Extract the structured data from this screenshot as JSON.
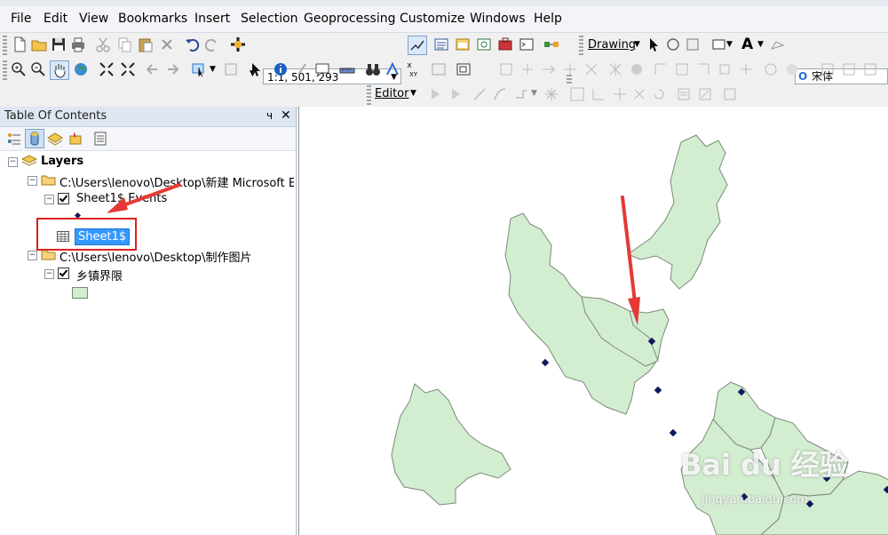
{
  "menu": [
    "File",
    "Edit",
    "View",
    "Bookmarks",
    "Insert",
    "Selection",
    "Geoprocessing",
    "Customize",
    "Windows",
    "Help"
  ],
  "toolbar": {
    "scale": "1:1, 501, 293",
    "drawing_label": "Drawing",
    "text_tool": "A",
    "font_name": "宋体",
    "editor_label": "Editor"
  },
  "toc": {
    "title": "Table Of Contents",
    "pin": "ч",
    "close": "✕",
    "root": "Layers",
    "folder1": "C:\\Users\\lenovo\\Desktop\\新建 Microsoft Ex",
    "layer1": "Sheet1$ Events",
    "table1": "Sheet1$",
    "folder2": "C:\\Users\\lenovo\\Desktop\\制作图片",
    "layer2": "乡镇界限"
  },
  "colors": {
    "polygon_fill": "#d3edd1",
    "polygon_stroke": "#7a8a78",
    "point": "#101a5a",
    "annotation": "#e53935",
    "selection": "#3399ff"
  },
  "watermark": {
    "brand": "Bai du 经验",
    "url": "jingyan.baidu.com"
  }
}
